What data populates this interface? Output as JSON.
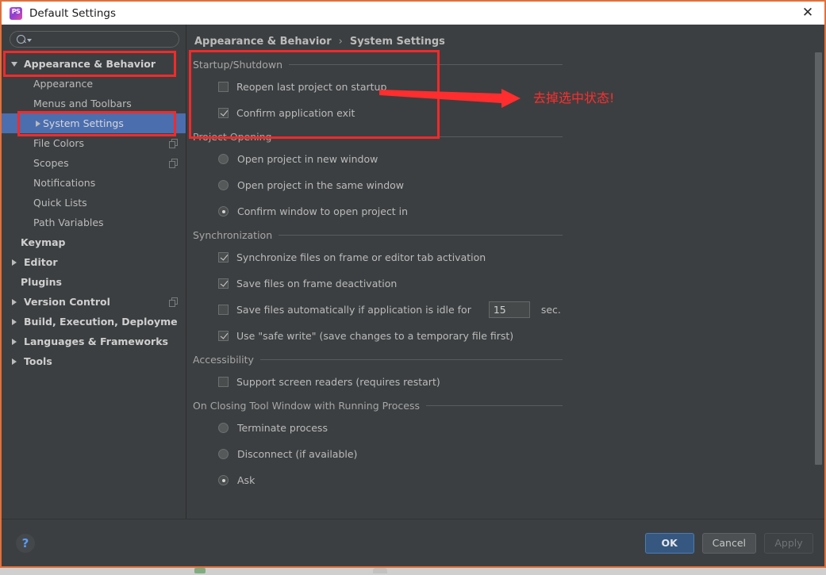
{
  "window": {
    "title": "Default Settings",
    "app_icon": "phpstorm-icon",
    "close_icon": "✕",
    "border_color": "#e2703a"
  },
  "search": {
    "value": "",
    "placeholder": "",
    "icon": "search-icon"
  },
  "sidebar": {
    "items": [
      {
        "label": "Appearance & Behavior",
        "level": 0,
        "twisty": "down",
        "bold": true,
        "selected": false,
        "badge": ""
      },
      {
        "label": "Appearance",
        "level": 1,
        "twisty": "",
        "bold": false,
        "selected": false,
        "badge": ""
      },
      {
        "label": "Menus and Toolbars",
        "level": 1,
        "twisty": "",
        "bold": false,
        "selected": false,
        "badge": ""
      },
      {
        "label": "System Settings",
        "level": 1,
        "twisty": "right",
        "bold": false,
        "selected": true,
        "badge": ""
      },
      {
        "label": "File Colors",
        "level": 1,
        "twisty": "",
        "bold": false,
        "selected": false,
        "badge": "copy-icon"
      },
      {
        "label": "Scopes",
        "level": 1,
        "twisty": "",
        "bold": false,
        "selected": false,
        "badge": "copy-icon"
      },
      {
        "label": "Notifications",
        "level": 1,
        "twisty": "",
        "bold": false,
        "selected": false,
        "badge": ""
      },
      {
        "label": "Quick Lists",
        "level": 1,
        "twisty": "",
        "bold": false,
        "selected": false,
        "badge": ""
      },
      {
        "label": "Path Variables",
        "level": 1,
        "twisty": "",
        "bold": false,
        "selected": false,
        "badge": ""
      },
      {
        "label": "Keymap",
        "level": 0,
        "twisty": "",
        "bold": true,
        "selected": false,
        "badge": ""
      },
      {
        "label": "Editor",
        "level": 0,
        "twisty": "right",
        "bold": true,
        "selected": false,
        "badge": ""
      },
      {
        "label": "Plugins",
        "level": 0,
        "twisty": "",
        "bold": true,
        "selected": false,
        "badge": ""
      },
      {
        "label": "Version Control",
        "level": 0,
        "twisty": "right",
        "bold": true,
        "selected": false,
        "badge": "copy-icon"
      },
      {
        "label": "Build, Execution, Deployment",
        "level": 0,
        "twisty": "right",
        "bold": true,
        "selected": false,
        "badge": ""
      },
      {
        "label": "Languages & Frameworks",
        "level": 0,
        "twisty": "right",
        "bold": true,
        "selected": false,
        "badge": ""
      },
      {
        "label": "Tools",
        "level": 0,
        "twisty": "right",
        "bold": true,
        "selected": false,
        "badge": ""
      }
    ]
  },
  "breadcrumb": {
    "root": "Appearance & Behavior",
    "separator": "›",
    "current": "System Settings"
  },
  "panel": {
    "groups": [
      {
        "title": "Startup/Shutdown",
        "options": [
          {
            "type": "checkbox",
            "label": "Reopen last project on startup",
            "checked": false
          },
          {
            "type": "checkbox",
            "label": "Confirm application exit",
            "checked": true
          }
        ]
      },
      {
        "title": "Project Opening",
        "options": [
          {
            "type": "radio",
            "label": "Open project in new window",
            "checked": false
          },
          {
            "type": "radio",
            "label": "Open project in the same window",
            "checked": false
          },
          {
            "type": "radio",
            "label": "Confirm window to open project in",
            "checked": true
          }
        ]
      },
      {
        "title": "Synchronization",
        "options": [
          {
            "type": "checkbox",
            "label": "Synchronize files on frame or editor tab activation",
            "checked": true
          },
          {
            "type": "checkbox",
            "label": "Save files on frame deactivation",
            "checked": true
          },
          {
            "type": "checkbox",
            "label": "Save files automatically if application is idle for",
            "checked": false,
            "field_value": "15",
            "unit": "sec."
          },
          {
            "type": "checkbox",
            "label": "Use \"safe write\" (save changes to a temporary file first)",
            "checked": true
          }
        ]
      },
      {
        "title": "Accessibility",
        "options": [
          {
            "type": "checkbox",
            "label": "Support screen readers (requires restart)",
            "checked": false
          }
        ]
      },
      {
        "title": "On Closing Tool Window with Running Process",
        "options": [
          {
            "type": "radio",
            "label": "Terminate process",
            "checked": false
          },
          {
            "type": "radio",
            "label": "Disconnect (if available)",
            "checked": false
          },
          {
            "type": "radio",
            "label": "Ask",
            "checked": true
          }
        ]
      }
    ]
  },
  "footer": {
    "help_icon": "?",
    "ok_label": "OK",
    "cancel_label": "Cancel",
    "apply_label": "Apply",
    "apply_disabled": true
  },
  "annotation": {
    "text": "去掉选中状态!",
    "color": "#ff2d2d"
  }
}
